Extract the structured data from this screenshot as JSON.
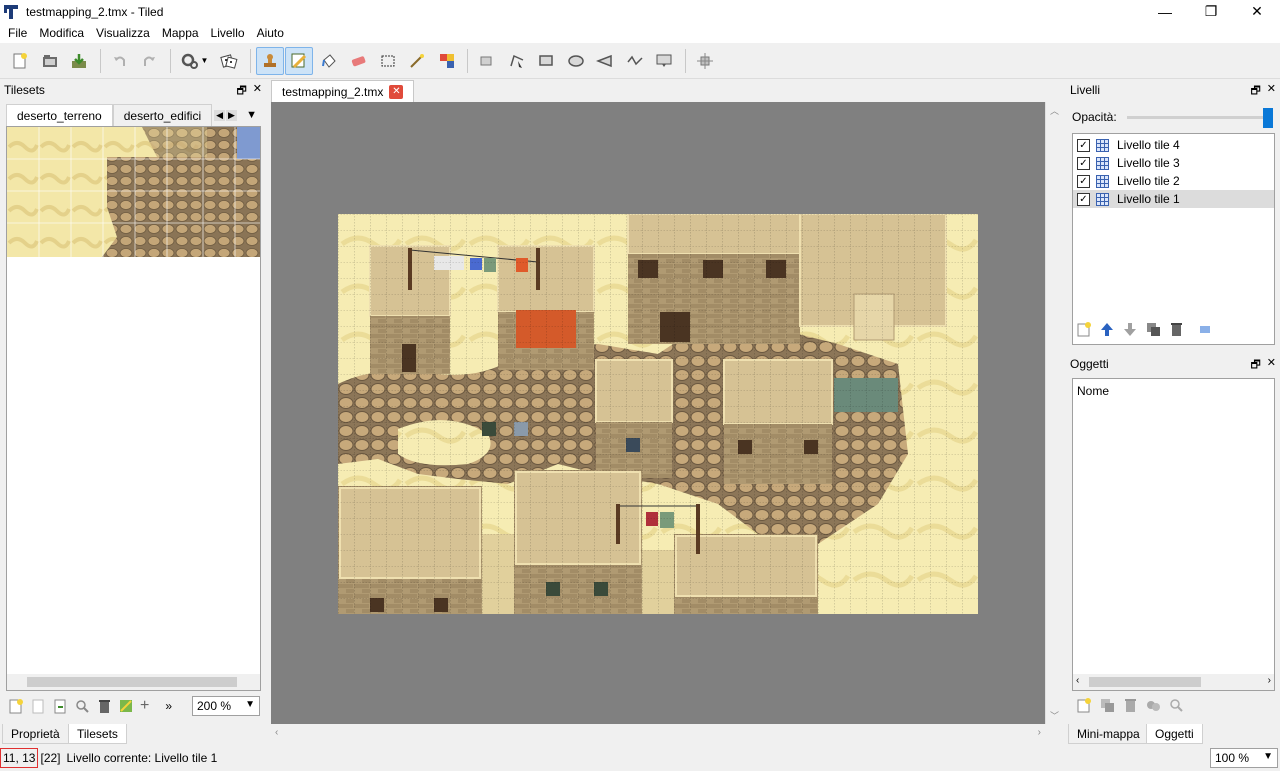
{
  "window": {
    "title": "testmapping_2.tmx - Tiled",
    "minimize": "—",
    "restore": "❐",
    "close": "✕"
  },
  "menu": {
    "items": [
      "File",
      "Modifica",
      "Visualizza",
      "Mappa",
      "Livello",
      "Aiuto"
    ]
  },
  "toolbar": {
    "buttons": [
      {
        "name": "new-map",
        "icon": "new-file-icon"
      },
      {
        "name": "open",
        "icon": "folder-icon"
      },
      {
        "name": "save",
        "icon": "save-icon"
      },
      {
        "name": "undo",
        "icon": "undo-icon"
      },
      {
        "name": "redo",
        "icon": "redo-icon"
      },
      {
        "name": "command",
        "icon": "gears-icon"
      },
      {
        "name": "random",
        "icon": "dice-icon"
      },
      {
        "name": "stamp-brush",
        "icon": "stamp-icon",
        "active": true
      },
      {
        "name": "terrain-brush",
        "icon": "pencil-icon",
        "active": true
      },
      {
        "name": "bucket-fill",
        "icon": "bucket-icon"
      },
      {
        "name": "eraser",
        "icon": "eraser-icon"
      },
      {
        "name": "rect-select",
        "icon": "rect-select-icon"
      },
      {
        "name": "magic-wand",
        "icon": "magic-wand-icon"
      },
      {
        "name": "select-same",
        "icon": "select-same-icon"
      }
    ]
  },
  "tilesets_panel": {
    "title": "Tilesets",
    "tabs": [
      "deserto_terreno",
      "deserto_edifici"
    ],
    "zoom": "200 %"
  },
  "document": {
    "tab": "testmapping_2.tmx"
  },
  "layers_panel": {
    "title": "Livelli",
    "opacity_label": "Opacità:",
    "layers": [
      {
        "name": "Livello tile 4",
        "visible": true,
        "selected": false
      },
      {
        "name": "Livello tile 3",
        "visible": true,
        "selected": false
      },
      {
        "name": "Livello tile 2",
        "visible": true,
        "selected": false
      },
      {
        "name": "Livello tile 1",
        "visible": true,
        "selected": true
      }
    ]
  },
  "objects_panel": {
    "title": "Oggetti",
    "column": "Nome"
  },
  "bottom_tabs_left": [
    "Proprietà",
    "Tilesets"
  ],
  "bottom_tabs_right": [
    "Mini-mappa",
    "Oggetti"
  ],
  "status": {
    "coords": "11, 13",
    "tile_id": "[22]",
    "current_layer": "Livello corrente: Livello tile 1",
    "zoom": "100 %"
  },
  "colors": {
    "sand": "#f5ebb0",
    "cobble": "#a08a68",
    "building": "#d3bf8e",
    "canvas_bg": "#808080",
    "selection": "#cde3f7"
  }
}
